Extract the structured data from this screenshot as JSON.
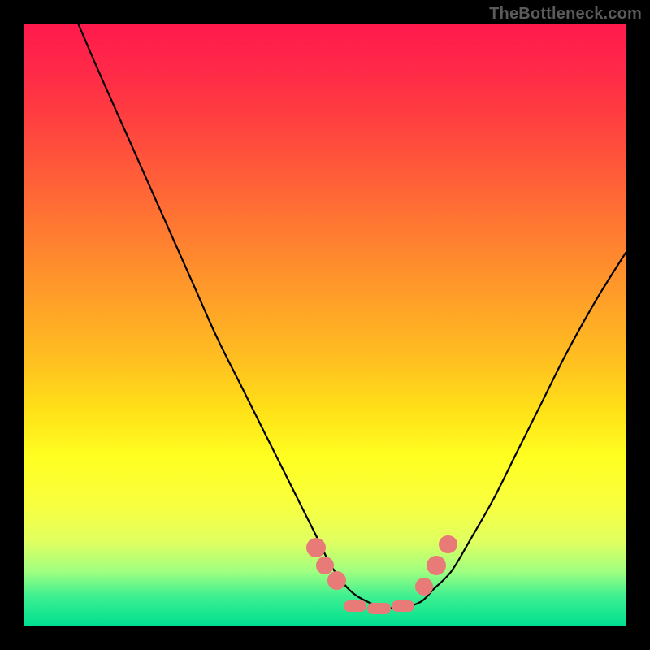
{
  "watermark": "TheBottleneck.com",
  "colors": {
    "frame": "#000000",
    "watermark": "#5a5a5a",
    "marker": "#e87b78",
    "curve": "#000000"
  },
  "chart_data": {
    "type": "line",
    "title": "",
    "xlabel": "",
    "ylabel": "",
    "xlim": [
      0,
      100
    ],
    "ylim": [
      0,
      100
    ],
    "grid": false,
    "legend": false,
    "note": "No numeric axes are shown in the image; x/y below are normalized 0–100 estimates read from pixel positions. The curve is a V/U shape: steep descent from upper-left to a flat trough near x≈55–65, y≈3, then a shallower rise toward the right edge.",
    "series": [
      {
        "name": "main-curve",
        "x": [
          9,
          12,
          16,
          20,
          24,
          28,
          32,
          36,
          40,
          44,
          47,
          49,
          51,
          54,
          57,
          60,
          63,
          66,
          68,
          71,
          74,
          78,
          82,
          86,
          90,
          95,
          100
        ],
        "y": [
          100,
          93,
          84,
          75,
          66,
          57,
          48,
          40,
          32,
          24,
          18,
          14,
          10,
          6,
          4,
          3,
          3,
          4,
          6,
          9,
          14,
          21,
          29,
          37,
          45,
          54,
          62
        ]
      }
    ],
    "markers": [
      {
        "name": "cluster-left-upper",
        "x": 48.5,
        "y": 13.0,
        "r": 1.5
      },
      {
        "name": "cluster-left-mid",
        "x": 50.0,
        "y": 10.0,
        "r": 1.4
      },
      {
        "name": "cluster-left-low",
        "x": 52.0,
        "y": 7.5,
        "r": 1.4
      },
      {
        "name": "trough-bar-left",
        "x": 55.0,
        "y": 3.2,
        "r": 1.2
      },
      {
        "name": "trough-bar",
        "x": 59.0,
        "y": 2.8,
        "r": 1.2
      },
      {
        "name": "trough-bar-right",
        "x": 63.0,
        "y": 3.2,
        "r": 1.2
      },
      {
        "name": "cluster-right-low",
        "x": 66.5,
        "y": 6.5,
        "r": 1.4
      },
      {
        "name": "cluster-right-mid",
        "x": 68.5,
        "y": 10.0,
        "r": 1.5
      },
      {
        "name": "cluster-right-upper",
        "x": 70.5,
        "y": 13.5,
        "r": 1.4
      }
    ]
  }
}
